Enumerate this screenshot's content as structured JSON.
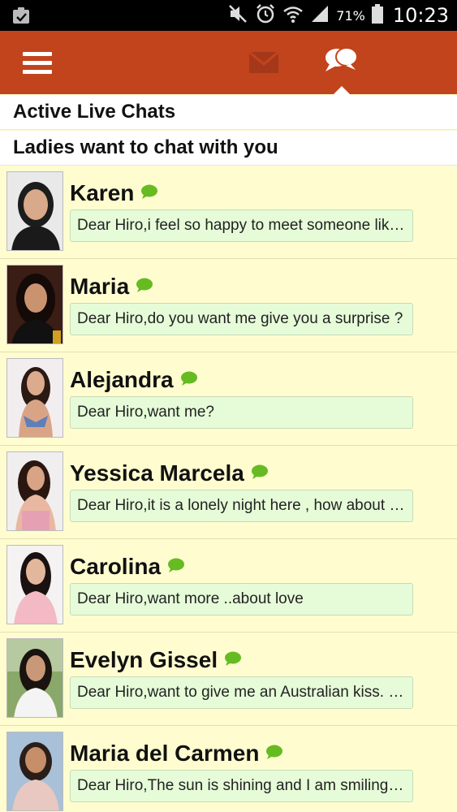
{
  "status_bar": {
    "battery": "71%",
    "time": "10:23"
  },
  "app_bar": {
    "menu_icon": "hamburger-menu-icon",
    "mail_icon": "mail-icon",
    "chat_icon": "chat-bubbles-icon"
  },
  "sections": {
    "active_title": "Active Live Chats",
    "ladies_title": "Ladies want to chat with you"
  },
  "chats": [
    {
      "name": "Karen",
      "message": "Dear Hiro,i feel so happy to meet someone like you…"
    },
    {
      "name": "Maria",
      "message": "Dear Hiro,do you want me give you a surprise ?"
    },
    {
      "name": "Alejandra",
      "message": "Dear Hiro,want me?"
    },
    {
      "name": "Yessica Marcela",
      "message": "Dear Hiro,it is a lonely night here , how about you…"
    },
    {
      "name": "Carolina",
      "message": "Dear Hiro,want more ..about love"
    },
    {
      "name": "Evelyn Gissel",
      "message": "Dear Hiro,want to give me an Australian kiss. It'…"
    },
    {
      "name": "Maria del Carmen",
      "message": "Dear Hiro,The sun is shining and I am smiling t…"
    }
  ],
  "colors": {
    "app_bar": "#c2441c",
    "list_background": "#fffdd0",
    "message_bubble": "#e6fcd8",
    "online_indicator": "#66bb22"
  }
}
